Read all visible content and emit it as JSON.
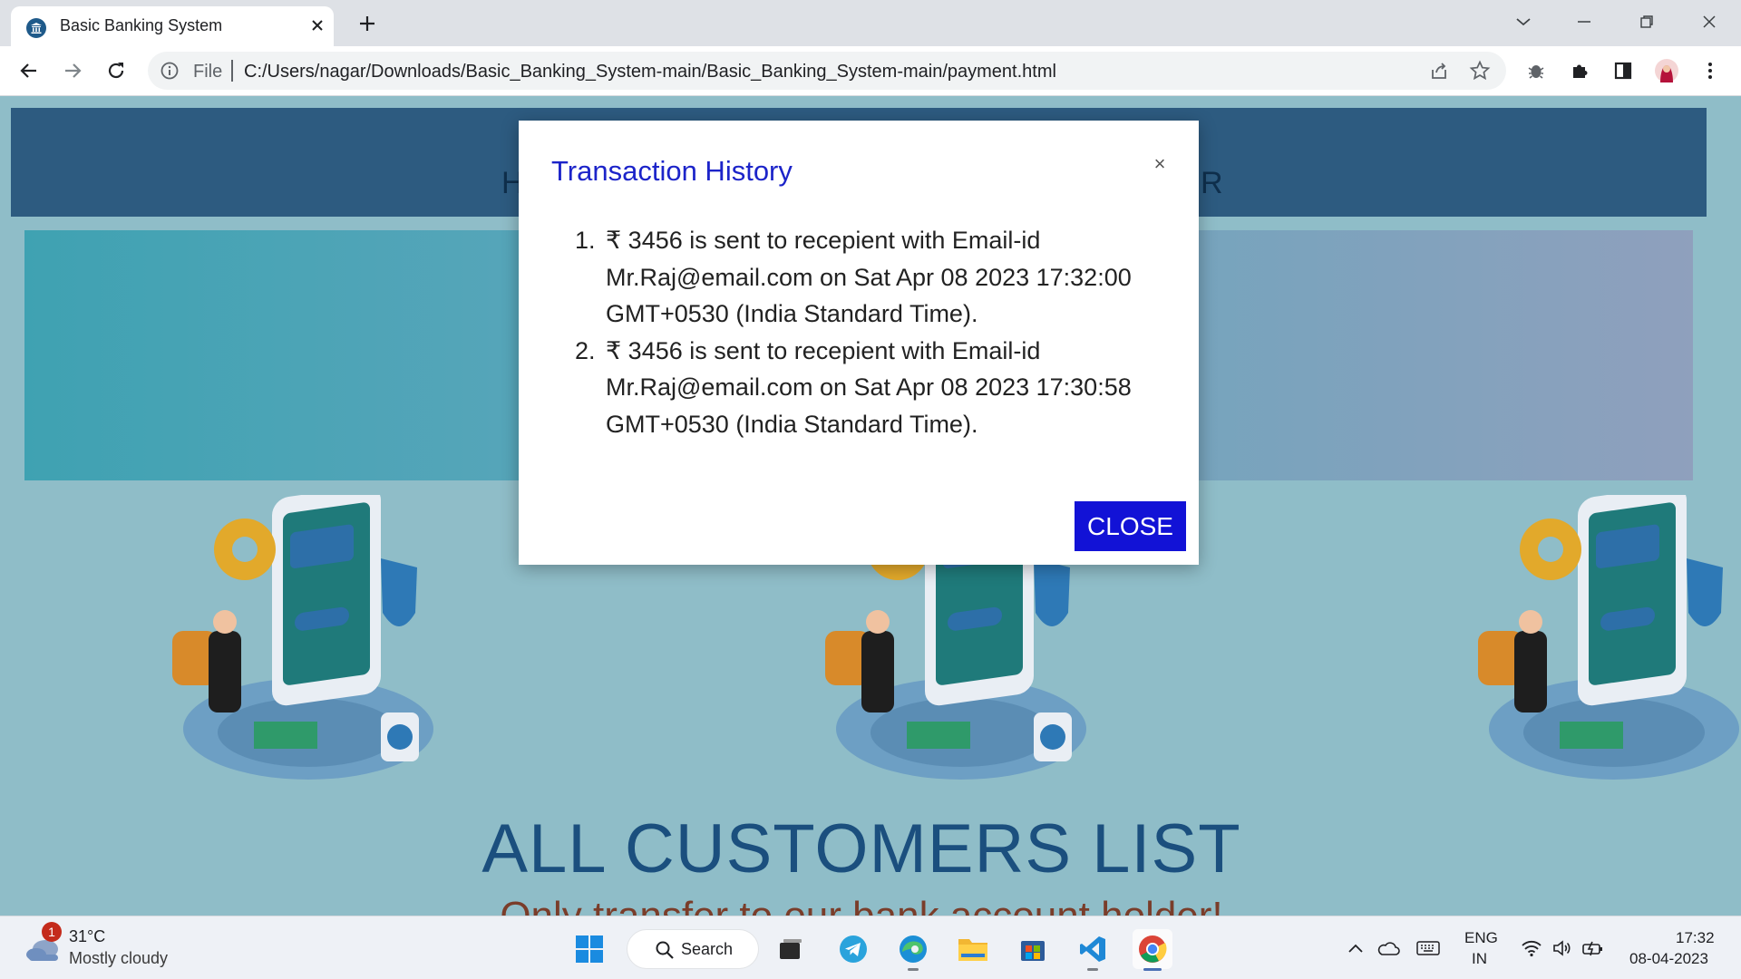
{
  "browser": {
    "tab_title": "Basic Banking System",
    "omnibox_scheme": "File",
    "url": "C:/Users/nagar/Downloads/Basic_Banking_System-main/Basic_Banking_System-main/payment.html"
  },
  "page": {
    "nav_fragment_left": "H",
    "nav_fragment_right": "R",
    "heading": "ALL CUSTOMERS LIST",
    "subheading": "Only transfer to our bank account holder!"
  },
  "modal": {
    "title": "Transaction History",
    "close_x": "×",
    "entries": [
      {
        "num": "1.",
        "text": "₹ 3456 is sent to recepient with Email-id Mr.Raj@email.com on Sat Apr 08 2023 17:32:00 GMT+0530 (India Standard Time)."
      },
      {
        "num": "2.",
        "text": "₹ 3456 is sent to recepient with Email-id Mr.Raj@email.com on Sat Apr 08 2023 17:30:58 GMT+0530 (India Standard Time)."
      }
    ],
    "close_label": "CLOSE"
  },
  "taskbar": {
    "weather_badge": "1",
    "weather_temp": "31°C",
    "weather_desc": "Mostly cloudy",
    "search_label": "Search",
    "lang_line1": "ENG",
    "lang_line2": "IN",
    "time": "17:32",
    "date": "08-04-2023"
  },
  "colors": {
    "navbar": "#2d5b80",
    "modal_title": "#1c24c9",
    "close_button": "#1212d6",
    "heading": "#1b4f7e"
  }
}
